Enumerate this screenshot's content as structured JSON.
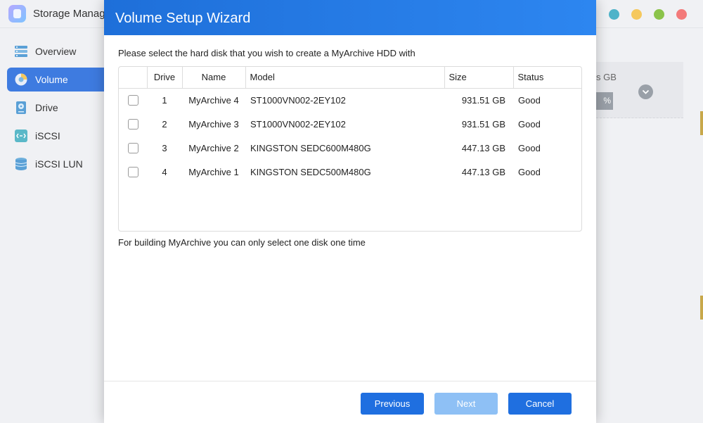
{
  "app": {
    "title": "Storage Manag"
  },
  "sidebar": {
    "items": [
      {
        "label": "Overview",
        "icon": "overview-icon",
        "active": false
      },
      {
        "label": "Volume",
        "icon": "volume-icon",
        "active": true
      },
      {
        "label": "Drive",
        "icon": "drive-icon",
        "active": false
      },
      {
        "label": "iSCSI",
        "icon": "iscsi-icon",
        "active": false
      },
      {
        "label": "iSCSI LUN",
        "icon": "iscsi-lun-icon",
        "active": false
      }
    ]
  },
  "background": {
    "panel_text": "s GB",
    "bar_text": "%"
  },
  "modal": {
    "title": "Volume Setup Wizard",
    "instruction": "Please select the hard disk that you wish to create a MyArchive HDD with",
    "columns": [
      "Drive",
      "Name",
      "Model",
      "Size",
      "Status"
    ],
    "rows": [
      {
        "drive": "1",
        "name": "MyArchive 4",
        "model": "ST1000VN002-2EY102",
        "size": "931.51 GB",
        "status": "Good"
      },
      {
        "drive": "2",
        "name": "MyArchive 3",
        "model": "ST1000VN002-2EY102",
        "size": "931.51 GB",
        "status": "Good"
      },
      {
        "drive": "3",
        "name": "MyArchive 2",
        "model": "KINGSTON SEDC600M480G",
        "size": "447.13 GB",
        "status": "Good"
      },
      {
        "drive": "4",
        "name": "MyArchive 1",
        "model": "KINGSTON SEDC500M480G",
        "size": "447.13 GB",
        "status": "Good"
      }
    ],
    "note": "For building MyArchive you can only select one disk one time",
    "buttons": {
      "previous": "Previous",
      "next": "Next",
      "cancel": "Cancel"
    }
  },
  "colors": {
    "accent": "#1f6fe0",
    "header": "#2d86f0",
    "disabled": "#8ec0f5"
  }
}
